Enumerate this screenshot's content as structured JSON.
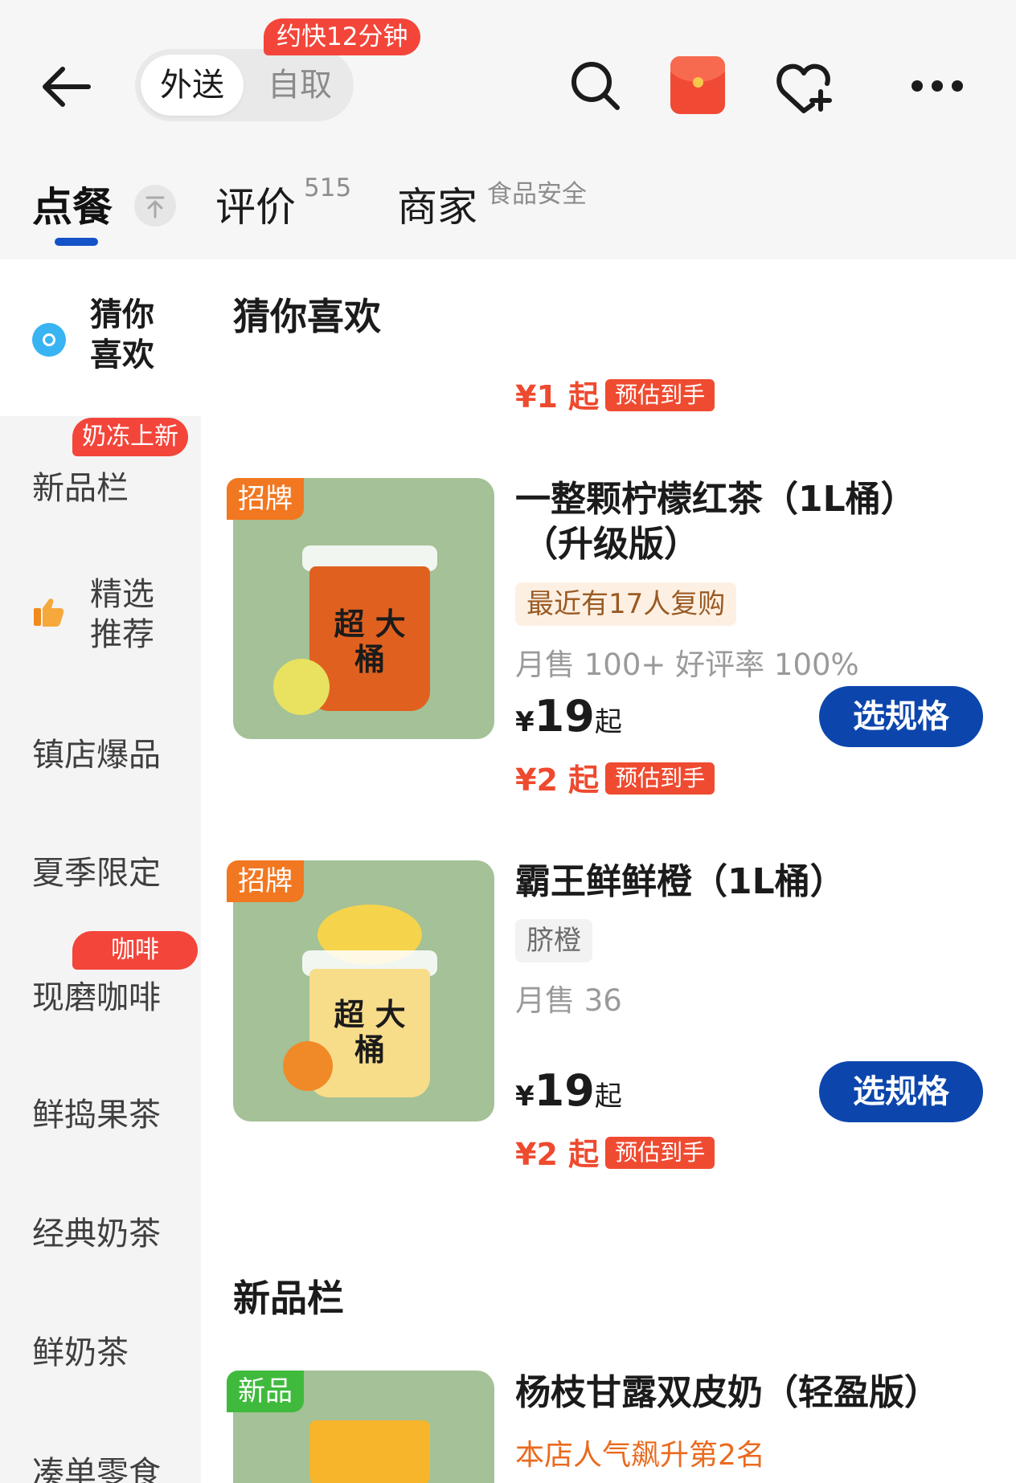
{
  "header": {
    "mode_delivery": "外送",
    "mode_pickup": "自取",
    "speed_badge": "约快12分钟"
  },
  "tabs": {
    "order": "点餐",
    "reviews": "评价",
    "reviews_count": "515",
    "merchant": "商家",
    "merchant_note": "食品安全"
  },
  "sidebar": {
    "active": "猜你\n喜欢",
    "items": [
      {
        "label": "新品栏",
        "badge": "奶冻上新"
      },
      {
        "label": "精选\n推荐"
      },
      {
        "label": "镇店爆品"
      },
      {
        "label": "夏季限定"
      },
      {
        "label": "现磨咖啡",
        "badge": "咖啡"
      },
      {
        "label": "鲜捣果茶"
      },
      {
        "label": "经典奶茶"
      },
      {
        "label": "鲜奶茶"
      },
      {
        "label": "凑单零食"
      }
    ]
  },
  "sections": {
    "guess": {
      "title": "猜你喜欢",
      "price_note": "¥1 起",
      "price_tag": "预估到手"
    },
    "new": {
      "title": "新品栏"
    }
  },
  "products": [
    {
      "badge": "招牌",
      "name_line1": "一整颗柠檬红茶（1L桶）",
      "name_line2": "（升级版）",
      "chip": "最近有17人复购",
      "sales": "月售 100+ 好评率 100%",
      "price_currency": "¥",
      "price": "19",
      "price_suffix": "起",
      "button": "选规格",
      "est_price": "¥2 起",
      "est_tag": "预估到手",
      "cup_text": "超\n大桶"
    },
    {
      "badge": "招牌",
      "name_line1": "霸王鲜鲜橙（1L桶）",
      "chip": "脐橙",
      "sales": "月售 36",
      "price_currency": "¥",
      "price": "19",
      "price_suffix": "起",
      "button": "选规格",
      "est_price": "¥2 起",
      "est_tag": "预估到手",
      "cup_text": "超\n大桶"
    },
    {
      "badge": "新品",
      "name_line1": "杨枝甘露双皮奶（轻盈版）",
      "rank": "本店人气飙升第2名"
    }
  ],
  "colors": {
    "accent_blue": "#0c46ad",
    "badge_red": "#f3453a",
    "price_red": "#ee4a2f",
    "badge_orange": "#f27721",
    "badge_green": "#3fba3d"
  },
  "icons": [
    "back-arrow-icon",
    "search-icon",
    "red-packet-icon",
    "favorite-add-icon",
    "more-icon",
    "collapse-up-icon",
    "guess-icon",
    "thumbs-up-icon"
  ]
}
